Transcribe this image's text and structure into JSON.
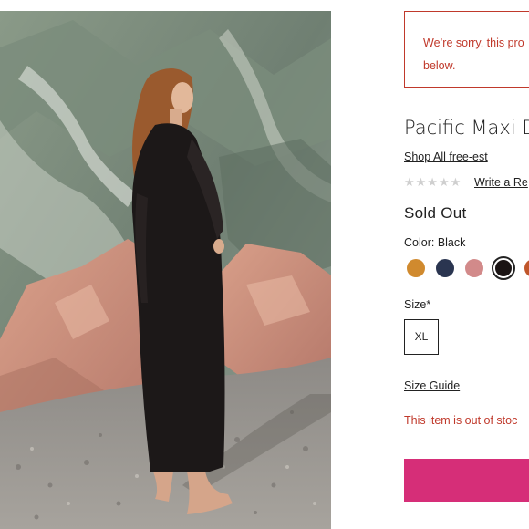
{
  "alert": {
    "message": "We’re sorry, this pro\nbelow."
  },
  "product": {
    "title": "Pacific Maxi Dr",
    "shop_all_link": "Shop All free-est",
    "rating_stars": "★★★★★",
    "review_link": "Write a Re",
    "status": "Sold Out",
    "color_label": "Color: Black",
    "swatches": [
      {
        "name": "mustard",
        "color": "#d08a2e"
      },
      {
        "name": "navy",
        "color": "#2a3550"
      },
      {
        "name": "pink",
        "color": "#d28a8a"
      },
      {
        "name": "black",
        "color": "#1a1414",
        "selected": true
      },
      {
        "name": "rust",
        "color": "#c0562a"
      }
    ],
    "size_label": "Size*",
    "size_option": "XL",
    "size_guide_link": "Size Guide",
    "out_of_stock_text": "This item is out of stoc"
  },
  "colors": {
    "error": "#c0392b",
    "cart_button": "#d62e78"
  }
}
